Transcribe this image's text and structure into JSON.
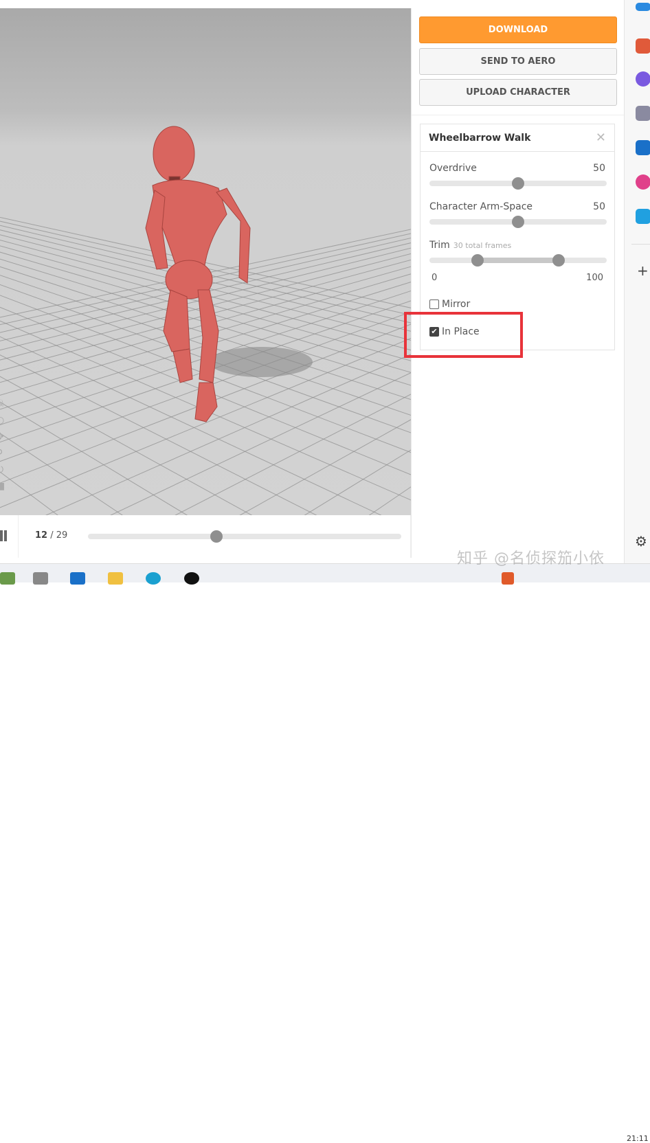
{
  "panel": {
    "download": "DOWNLOAD",
    "send_to_aero": "SEND TO AERO",
    "upload_character": "UPLOAD CHARACTER"
  },
  "animation": {
    "title": "Wheelbarrow Walk",
    "close": "✕",
    "overdrive": {
      "label": "Overdrive",
      "value": "50"
    },
    "arm_space": {
      "label": "Character Arm-Space",
      "value": "50"
    },
    "trim": {
      "label": "Trim",
      "note": "30 total frames",
      "min": "0",
      "max": "100",
      "start_pct": 27,
      "end_pct": 73
    },
    "mirror": {
      "label": "Mirror",
      "checked": false
    },
    "in_place": {
      "label": "In Place",
      "checked": true
    }
  },
  "timeline": {
    "current": "12",
    "separator": "/",
    "total": "29",
    "progress_pct": 41
  },
  "watermark": "知乎 @名侦探笳小依",
  "clock": "21:11",
  "colors": {
    "accent": "#ff9a30",
    "highlight": "#e8333a"
  }
}
